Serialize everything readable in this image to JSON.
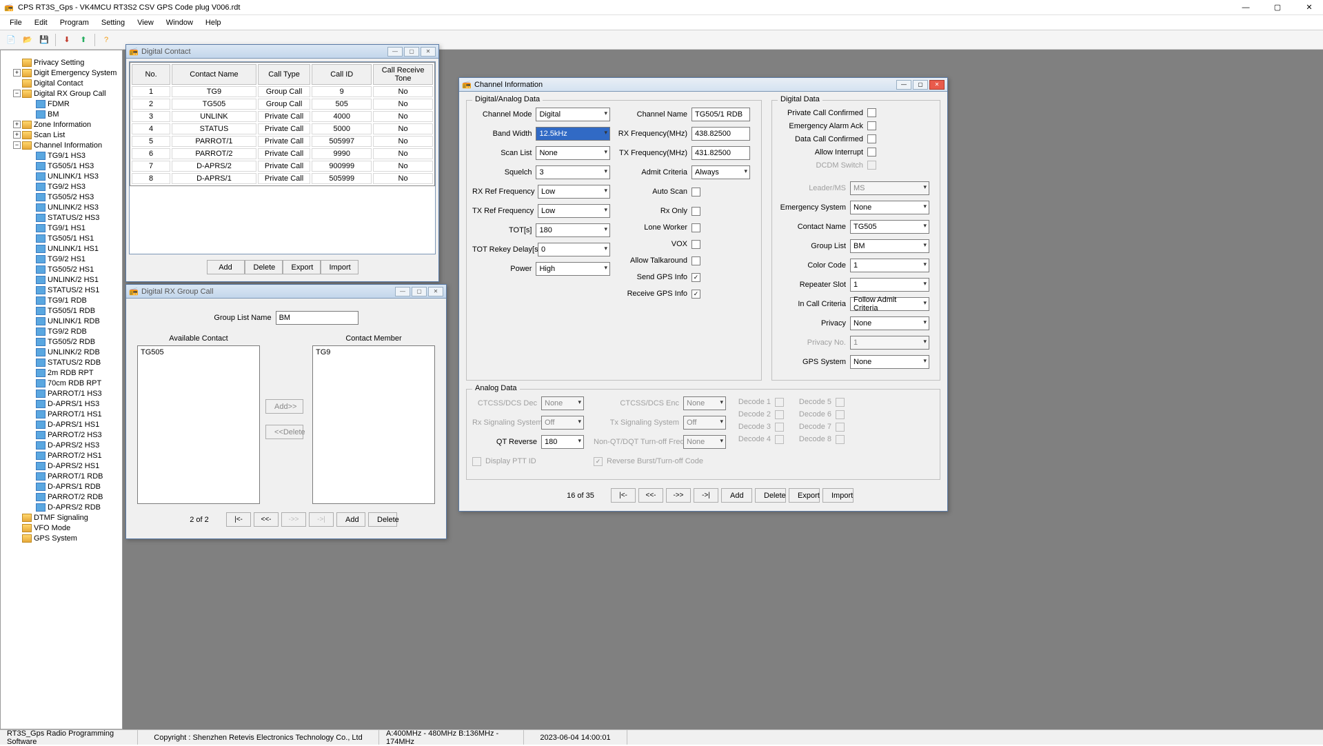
{
  "window": {
    "title": "CPS RT3S_Gps - VK4MCU RT3S2 CSV GPS Code plug V006.rdt"
  },
  "menubar": [
    "File",
    "Edit",
    "Program",
    "Setting",
    "View",
    "Window",
    "Help"
  ],
  "tree": [
    {
      "depth": 0,
      "expand": "",
      "icon": "folder",
      "label": "Privacy Setting"
    },
    {
      "depth": 0,
      "expand": "+",
      "icon": "folder",
      "label": "Digit Emergency System"
    },
    {
      "depth": 0,
      "expand": "",
      "icon": "folder",
      "label": "Digital Contact"
    },
    {
      "depth": 0,
      "expand": "-",
      "icon": "folder",
      "label": "Digital RX Group Call"
    },
    {
      "depth": 1,
      "expand": "",
      "icon": "leaf",
      "label": "FDMR"
    },
    {
      "depth": 1,
      "expand": "",
      "icon": "leaf",
      "label": "BM"
    },
    {
      "depth": 0,
      "expand": "+",
      "icon": "folder",
      "label": "Zone Information"
    },
    {
      "depth": 0,
      "expand": "+",
      "icon": "folder",
      "label": "Scan List"
    },
    {
      "depth": 0,
      "expand": "-",
      "icon": "folder",
      "label": "Channel Information"
    },
    {
      "depth": 1,
      "expand": "",
      "icon": "leaf",
      "label": "TG9/1 HS3"
    },
    {
      "depth": 1,
      "expand": "",
      "icon": "leaf",
      "label": "TG505/1 HS3"
    },
    {
      "depth": 1,
      "expand": "",
      "icon": "leaf",
      "label": "UNLINK/1 HS3"
    },
    {
      "depth": 1,
      "expand": "",
      "icon": "leaf",
      "label": "TG9/2 HS3"
    },
    {
      "depth": 1,
      "expand": "",
      "icon": "leaf",
      "label": "TG505/2 HS3"
    },
    {
      "depth": 1,
      "expand": "",
      "icon": "leaf",
      "label": "UNLINK/2 HS3"
    },
    {
      "depth": 1,
      "expand": "",
      "icon": "leaf",
      "label": "STATUS/2 HS3"
    },
    {
      "depth": 1,
      "expand": "",
      "icon": "leaf",
      "label": "TG9/1 HS1"
    },
    {
      "depth": 1,
      "expand": "",
      "icon": "leaf",
      "label": "TG505/1 HS1"
    },
    {
      "depth": 1,
      "expand": "",
      "icon": "leaf",
      "label": "UNLINK/1 HS1"
    },
    {
      "depth": 1,
      "expand": "",
      "icon": "leaf",
      "label": "TG9/2 HS1"
    },
    {
      "depth": 1,
      "expand": "",
      "icon": "leaf",
      "label": "TG505/2 HS1"
    },
    {
      "depth": 1,
      "expand": "",
      "icon": "leaf",
      "label": "UNLINK/2 HS1"
    },
    {
      "depth": 1,
      "expand": "",
      "icon": "leaf",
      "label": "STATUS/2 HS1"
    },
    {
      "depth": 1,
      "expand": "",
      "icon": "leaf",
      "label": "TG9/1 RDB"
    },
    {
      "depth": 1,
      "expand": "",
      "icon": "leaf",
      "label": "TG505/1 RDB"
    },
    {
      "depth": 1,
      "expand": "",
      "icon": "leaf",
      "label": "UNLINK/1 RDB"
    },
    {
      "depth": 1,
      "expand": "",
      "icon": "leaf",
      "label": "TG9/2 RDB"
    },
    {
      "depth": 1,
      "expand": "",
      "icon": "leaf",
      "label": "TG505/2 RDB"
    },
    {
      "depth": 1,
      "expand": "",
      "icon": "leaf",
      "label": "UNLINK/2 RDB"
    },
    {
      "depth": 1,
      "expand": "",
      "icon": "leaf",
      "label": "STATUS/2 RDB"
    },
    {
      "depth": 1,
      "expand": "",
      "icon": "leaf",
      "label": "2m RDB RPT"
    },
    {
      "depth": 1,
      "expand": "",
      "icon": "leaf",
      "label": "70cm RDB RPT"
    },
    {
      "depth": 1,
      "expand": "",
      "icon": "leaf",
      "label": "PARROT/1 HS3"
    },
    {
      "depth": 1,
      "expand": "",
      "icon": "leaf",
      "label": "D-APRS/1 HS3"
    },
    {
      "depth": 1,
      "expand": "",
      "icon": "leaf",
      "label": "PARROT/1 HS1"
    },
    {
      "depth": 1,
      "expand": "",
      "icon": "leaf",
      "label": "D-APRS/1 HS1"
    },
    {
      "depth": 1,
      "expand": "",
      "icon": "leaf",
      "label": "PARROT/2 HS3"
    },
    {
      "depth": 1,
      "expand": "",
      "icon": "leaf",
      "label": "D-APRS/2 HS3"
    },
    {
      "depth": 1,
      "expand": "",
      "icon": "leaf",
      "label": "PARROT/2 HS1"
    },
    {
      "depth": 1,
      "expand": "",
      "icon": "leaf",
      "label": "D-APRS/2 HS1"
    },
    {
      "depth": 1,
      "expand": "",
      "icon": "leaf",
      "label": "PARROT/1 RDB"
    },
    {
      "depth": 1,
      "expand": "",
      "icon": "leaf",
      "label": "D-APRS/1 RDB"
    },
    {
      "depth": 1,
      "expand": "",
      "icon": "leaf",
      "label": "PARROT/2 RDB"
    },
    {
      "depth": 1,
      "expand": "",
      "icon": "leaf",
      "label": "D-APRS/2 RDB"
    },
    {
      "depth": 0,
      "expand": "",
      "icon": "folder",
      "label": "DTMF Signaling"
    },
    {
      "depth": 0,
      "expand": "",
      "icon": "folder",
      "label": "VFO Mode"
    },
    {
      "depth": 0,
      "expand": "",
      "icon": "folder",
      "label": "GPS System"
    }
  ],
  "digital_contact": {
    "title": "Digital Contact",
    "headers": [
      "No.",
      "Contact Name",
      "Call Type",
      "Call ID",
      "Call Receive Tone"
    ],
    "rows": [
      [
        "1",
        "TG9",
        "Group Call",
        "9",
        "No"
      ],
      [
        "2",
        "TG505",
        "Group Call",
        "505",
        "No"
      ],
      [
        "3",
        "UNLINK",
        "Private Call",
        "4000",
        "No"
      ],
      [
        "4",
        "STATUS",
        "Private Call",
        "5000",
        "No"
      ],
      [
        "5",
        "PARROT/1",
        "Private Call",
        "505997",
        "No"
      ],
      [
        "6",
        "PARROT/2",
        "Private Call",
        "9990",
        "No"
      ],
      [
        "7",
        "D-APRS/2",
        "Private Call",
        "900999",
        "No"
      ],
      [
        "8",
        "D-APRS/1",
        "Private Call",
        "505999",
        "No"
      ]
    ],
    "buttons": {
      "add": "Add",
      "delete": "Delete",
      "export": "Export",
      "import": "Import"
    }
  },
  "rx_group": {
    "title": "Digital RX Group Call",
    "group_list_name_label": "Group List Name",
    "group_list_name_value": "BM",
    "available_label": "Available Contact",
    "member_label": "Contact Member",
    "available_items": [
      "TG505"
    ],
    "member_items": [
      "TG9"
    ],
    "add_btn": "Add>>",
    "del_btn": "<<Delete",
    "counter": "2 of 2",
    "nav": {
      "first": "|<-",
      "prev": "<<-",
      "next": "->>",
      "last": "->|"
    },
    "footer_add": "Add",
    "footer_delete": "Delete"
  },
  "channel_info": {
    "title": "Channel Information",
    "digital_analog_legend": "Digital/Analog Data",
    "digital_legend": "Digital Data",
    "analog_legend": "Analog Data",
    "labels": {
      "channel_mode": "Channel Mode",
      "band_width": "Band Width",
      "scan_list": "Scan List",
      "squelch": "Squelch",
      "rx_ref": "RX Ref Frequency",
      "tx_ref": "TX Ref Frequency",
      "tot": "TOT[s]",
      "tot_rekey": "TOT Rekey Delay[s]",
      "power": "Power",
      "channel_name": "Channel Name",
      "rx_freq": "RX Frequency(MHz)",
      "tx_freq": "TX Frequency(MHz)",
      "admit": "Admit Criteria",
      "auto_scan": "Auto Scan",
      "rx_only": "Rx Only",
      "lone_worker": "Lone Worker",
      "vox": "VOX",
      "allow_talkaround": "Allow Talkaround",
      "send_gps": "Send GPS Info",
      "receive_gps": "Receive GPS Info",
      "priv_call_conf": "Private Call Confirmed",
      "emergency_ack": "Emergency Alarm Ack",
      "data_call_conf": "Data Call Confirmed",
      "allow_interrupt": "Allow Interrupt",
      "dcdm": "DCDM Switch",
      "leader_ms": "Leader/MS",
      "emergency_system": "Emergency System",
      "contact_name": "Contact Name",
      "group_list": "Group List",
      "color_code": "Color Code",
      "repeater_slot": "Repeater Slot",
      "in_call": "In Call Criteria",
      "privacy": "Privacy",
      "privacy_no": "Privacy No.",
      "gps_system": "GPS System",
      "ctcss_dec": "CTCSS/DCS Dec",
      "ctcss_enc": "CTCSS/DCS Enc",
      "rx_sig": "Rx Signaling System",
      "tx_sig": "Tx Signaling System",
      "qt_rev": "QT Reverse",
      "non_qt": "Non-QT/DQT Turn-off Freq",
      "display_ptt": "Display PTT ID",
      "reverse_burst": "Reverse Burst/Turn-off Code",
      "decode1": "Decode 1",
      "decode2": "Decode 2",
      "decode3": "Decode 3",
      "decode4": "Decode 4",
      "decode5": "Decode 5",
      "decode6": "Decode 6",
      "decode7": "Decode 7",
      "decode8": "Decode 8"
    },
    "values": {
      "channel_mode": "Digital",
      "band_width": "12.5kHz",
      "scan_list": "None",
      "squelch": "3",
      "rx_ref": "Low",
      "tx_ref": "Low",
      "tot": "180",
      "tot_rekey": "0",
      "power": "High",
      "channel_name": "TG505/1 RDB",
      "rx_freq": "438.82500",
      "tx_freq": "431.82500",
      "admit": "Always",
      "leader_ms": "MS",
      "emergency_system": "None",
      "contact_name": "TG505",
      "group_list": "BM",
      "color_code": "1",
      "repeater_slot": "1",
      "in_call": "Follow Admit Criteria",
      "privacy": "None",
      "privacy_no": "1",
      "gps_system": "None",
      "ctcss_dec": "None",
      "ctcss_enc": "None",
      "rx_sig": "Off",
      "tx_sig": "Off",
      "qt_rev": "180",
      "non_qt": "None"
    },
    "counter": "16 of 35",
    "buttons": {
      "add": "Add",
      "delete": "Delete",
      "export": "Export",
      "import": "Import"
    }
  },
  "statusbar": {
    "cell1": "RT3S_Gps Radio Programming Software",
    "cell2": "Copyright : Shenzhen Retevis Electronics Technology Co., Ltd",
    "cell3": "A:400MHz - 480MHz B:136MHz - 174MHz",
    "cell4": "2023-06-04 14:00:01"
  }
}
